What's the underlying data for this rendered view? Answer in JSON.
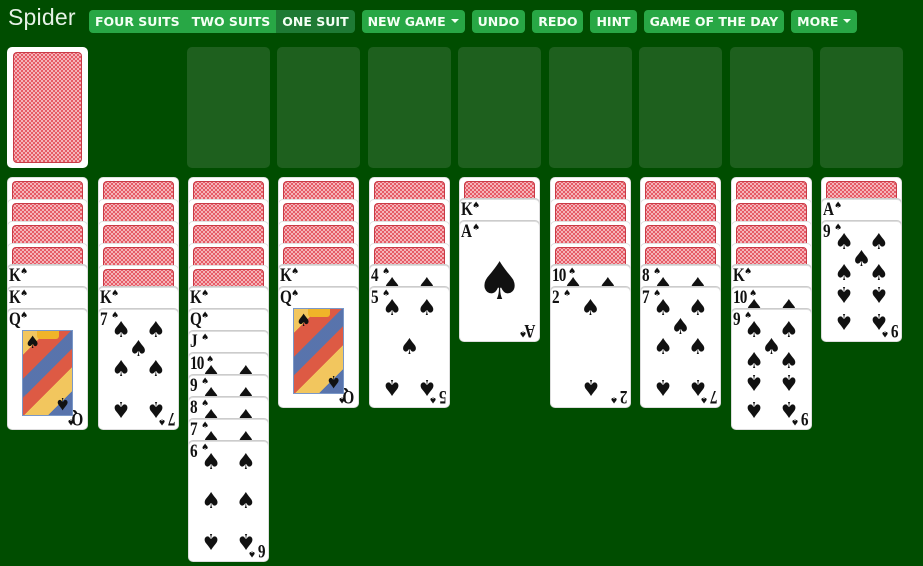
{
  "app": {
    "title": "Spider"
  },
  "toolbar": {
    "suit_modes": [
      {
        "label": "FOUR SUITS",
        "active": false
      },
      {
        "label": "TWO SUITS",
        "active": false
      },
      {
        "label": "ONE SUIT",
        "active": true
      }
    ],
    "buttons": [
      {
        "label": "NEW GAME",
        "dropdown": true
      },
      {
        "label": "UNDO",
        "dropdown": false
      },
      {
        "label": "REDO",
        "dropdown": false
      },
      {
        "label": "HINT",
        "dropdown": false
      },
      {
        "label": "GAME OF THE DAY",
        "dropdown": false
      },
      {
        "label": "MORE",
        "dropdown": true
      }
    ]
  },
  "colors": {
    "table": "#004d00",
    "button": "#28a745",
    "button_active": "#1e7a34",
    "foundation": "#1e601e",
    "card_back": "#e65b66"
  },
  "stock": {
    "face_down": true
  },
  "foundations_count": 8,
  "suit_symbol": "♠",
  "tableau": [
    {
      "face_down": 4,
      "face_up": [
        "K",
        "K",
        "Q"
      ]
    },
    {
      "face_down": 5,
      "face_up": [
        "K",
        "7"
      ]
    },
    {
      "face_down": 5,
      "face_up": [
        "K",
        "Q",
        "J",
        "10",
        "9",
        "8",
        "7",
        "6"
      ]
    },
    {
      "face_down": 4,
      "face_up": [
        "K",
        "Q"
      ]
    },
    {
      "face_down": 4,
      "face_up": [
        "4",
        "5"
      ]
    },
    {
      "face_down": 1,
      "face_up": [
        "K",
        "A"
      ]
    },
    {
      "face_down": 4,
      "face_up": [
        "10",
        "2"
      ]
    },
    {
      "face_down": 4,
      "face_up": [
        "8",
        "7"
      ]
    },
    {
      "face_down": 4,
      "face_up": [
        "K",
        "10",
        "9"
      ]
    },
    {
      "face_down": 1,
      "face_up": [
        "A",
        "9"
      ]
    }
  ]
}
